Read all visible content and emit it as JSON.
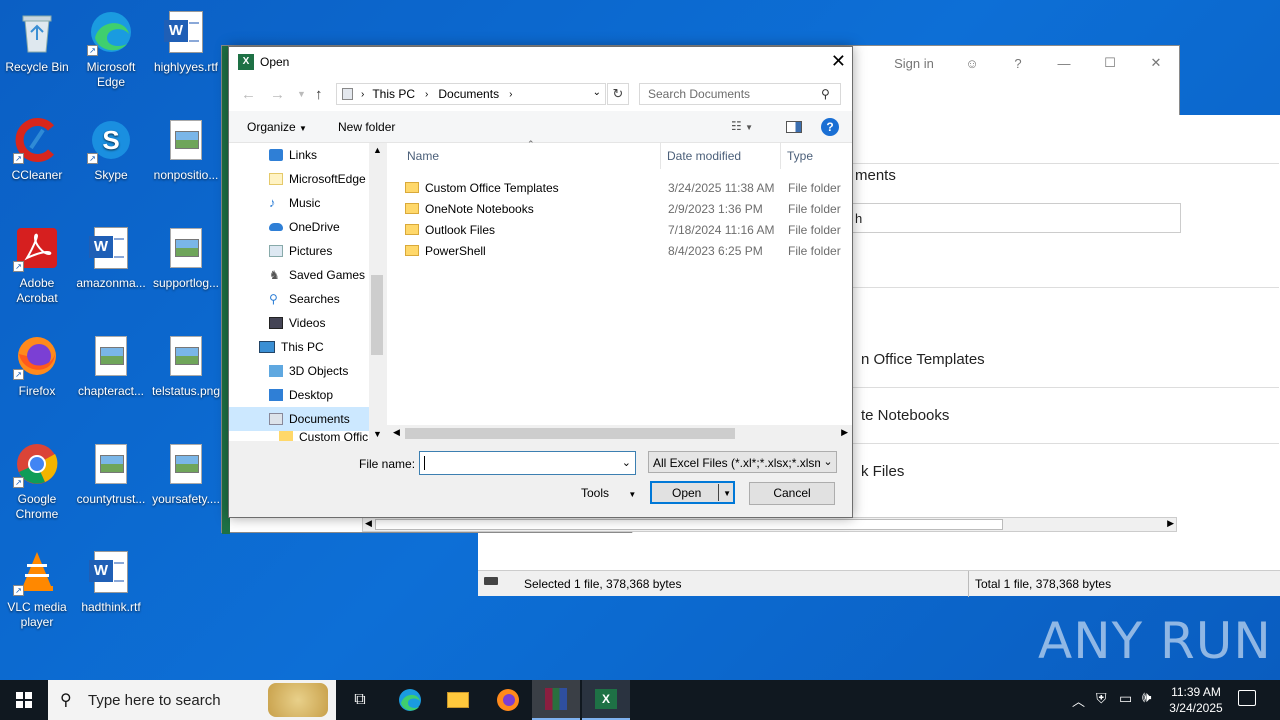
{
  "desktop": {
    "icons": [
      {
        "label": "Recycle Bin",
        "label2": ""
      },
      {
        "label": "Microsoft",
        "label2": "Edge"
      },
      {
        "label": "highlyyes.rtf",
        "label2": ""
      },
      {
        "label": "CCleaner",
        "label2": ""
      },
      {
        "label": "Skype",
        "label2": ""
      },
      {
        "label": "nonpositio...",
        "label2": ""
      },
      {
        "label": "Adobe",
        "label2": "Acrobat"
      },
      {
        "label": "amazonma...",
        "label2": ""
      },
      {
        "label": "supportlog...",
        "label2": ""
      },
      {
        "label": "Firefox",
        "label2": ""
      },
      {
        "label": "chapteract...",
        "label2": ""
      },
      {
        "label": "telstatus.png",
        "label2": ""
      },
      {
        "label": "Google",
        "label2": "Chrome"
      },
      {
        "label": "countytrust...",
        "label2": ""
      },
      {
        "label": "yoursafety....",
        "label2": ""
      },
      {
        "label": "VLC media",
        "label2": "player"
      },
      {
        "label": "hadthink.rtf",
        "label2": ""
      }
    ]
  },
  "excel": {
    "sign_in": "Sign in",
    "help": "?",
    "bg_items": [
      "ments",
      "h",
      "n Office Templates",
      "te Notebooks",
      "k Files"
    ],
    "status_left": "Selected 1 file, 378,368 bytes",
    "status_right": "Total 1 file, 378,368 bytes"
  },
  "dialog": {
    "title": "Open",
    "address": {
      "segments": [
        "This PC",
        "Documents"
      ]
    },
    "search_placeholder": "Search Documents",
    "organize": "Organize",
    "new_folder": "New folder",
    "nav_items": [
      {
        "label": "Links",
        "indent": 2
      },
      {
        "label": "MicrosoftEdge",
        "indent": 2
      },
      {
        "label": "Music",
        "indent": 2
      },
      {
        "label": "OneDrive",
        "indent": 2
      },
      {
        "label": "Pictures",
        "indent": 2
      },
      {
        "label": "Saved Games",
        "indent": 2
      },
      {
        "label": "Searches",
        "indent": 2
      },
      {
        "label": "Videos",
        "indent": 2
      },
      {
        "label": "This PC",
        "indent": 1
      },
      {
        "label": "3D Objects",
        "indent": 2
      },
      {
        "label": "Desktop",
        "indent": 2
      },
      {
        "label": "Documents",
        "indent": 2
      },
      {
        "label": "Custom Offic",
        "indent": 3
      }
    ],
    "columns": {
      "name": "Name",
      "date": "Date modified",
      "type": "Type"
    },
    "files": [
      {
        "name": "Custom Office Templates",
        "date": "3/24/2025 11:38 AM",
        "type": "File folder"
      },
      {
        "name": "OneNote Notebooks",
        "date": "2/9/2023 1:36 PM",
        "type": "File folder"
      },
      {
        "name": "Outlook Files",
        "date": "7/18/2024 11:16 AM",
        "type": "File folder"
      },
      {
        "name": "PowerShell",
        "date": "8/4/2023 6:25 PM",
        "type": "File folder"
      }
    ],
    "file_name_label": "File name:",
    "file_name_value": "",
    "filter": "All Excel Files (*.xl*;*.xlsx;*.xlsm",
    "tools": "Tools",
    "open": "Open",
    "cancel": "Cancel"
  },
  "taskbar": {
    "search_placeholder": "Type here to search",
    "time": "11:39 AM",
    "date": "3/24/2025"
  },
  "watermark": "ANY RUN"
}
